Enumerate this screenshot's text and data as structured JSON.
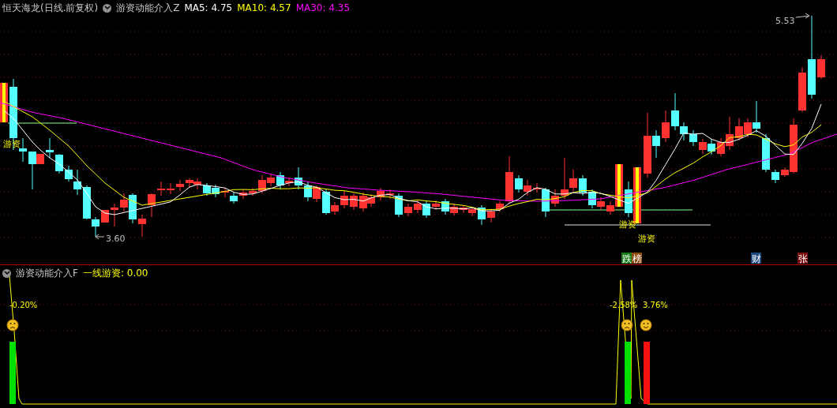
{
  "title": {
    "stock": "恒天海龙(日线.前复权)",
    "indicator": "游资动能介入Z"
  },
  "ma_legend": [
    {
      "label": "MA5: 4.75",
      "color": "#ffffff"
    },
    {
      "label": "MA10: 4.57",
      "color": "#ffff00"
    },
    {
      "label": "MA30: 4.35",
      "color": "#ff00ff"
    }
  ],
  "price_labels": [
    "5.53",
    "3.60"
  ],
  "signals": [
    "游资",
    "游资",
    "游资"
  ],
  "event_badges": [
    {
      "label": "跌",
      "color": "#1a7f1a"
    },
    {
      "label": "榜",
      "color": "#8b4a10"
    },
    {
      "label": "财",
      "color": "#1f4a80"
    },
    {
      "label": "张",
      "color": "#7a1010"
    }
  ],
  "lower_panel": {
    "indicator": "游资动能介入F",
    "value": "一线游资: 0.00",
    "readings": [
      "-0.20%",
      "-2.58%",
      "3.76%"
    ]
  }
}
